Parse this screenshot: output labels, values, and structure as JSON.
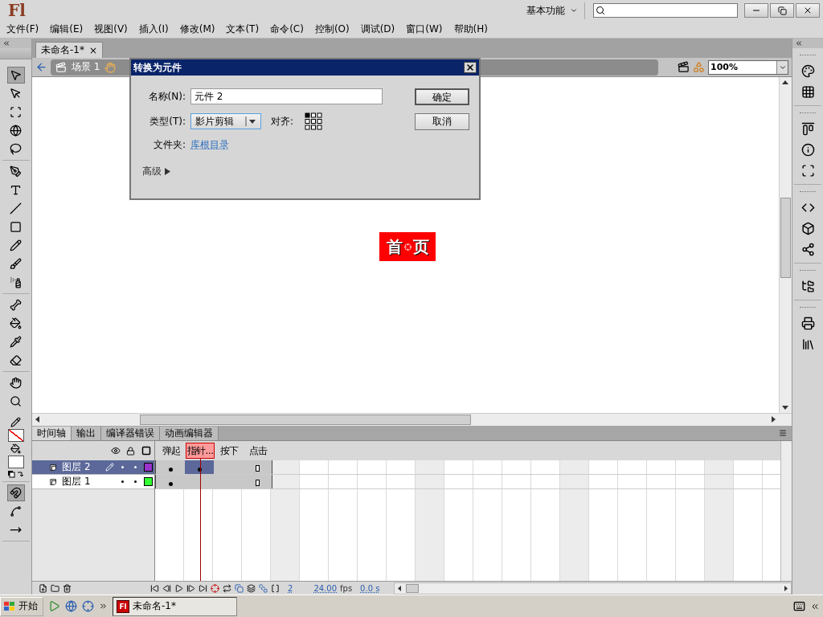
{
  "app": {
    "logo": "Fl",
    "workspace": "基本功能"
  },
  "menu": [
    "文件(F)",
    "编辑(E)",
    "视图(V)",
    "插入(I)",
    "修改(M)",
    "文本(T)",
    "命令(C)",
    "控制(O)",
    "调试(D)",
    "窗口(W)",
    "帮助(H)"
  ],
  "document_tab": {
    "title": "未命名-1*",
    "close": "×"
  },
  "edit_bar": {
    "scene": "场景 1",
    "zoom": "100%"
  },
  "tool_groups": [
    {
      "tools": [
        {
          "kind": "selection",
          "selected": true
        },
        {
          "kind": "subselection",
          "selected": false
        },
        {
          "kind": "transform",
          "selected": false
        },
        {
          "kind": "rotation",
          "selected": false
        },
        {
          "kind": "lasso",
          "selected": false
        }
      ]
    },
    {
      "tools": [
        {
          "kind": "pen",
          "selected": false
        },
        {
          "kind": "text",
          "selected": false
        },
        {
          "kind": "line",
          "selected": false
        },
        {
          "kind": "rectangle",
          "selected": false
        },
        {
          "kind": "pencil",
          "selected": false
        },
        {
          "kind": "brush",
          "selected": false
        },
        {
          "kind": "deco",
          "selected": false
        }
      ]
    },
    {
      "tools": [
        {
          "kind": "bone",
          "selected": false
        },
        {
          "kind": "bucket",
          "selected": false
        },
        {
          "kind": "eyedropper",
          "selected": false
        },
        {
          "kind": "eraser",
          "selected": false
        }
      ]
    },
    {
      "tools": [
        {
          "kind": "hand",
          "selected": false
        },
        {
          "kind": "zoom",
          "selected": false
        }
      ]
    },
    {
      "tools": [
        {
          "kind": "snap",
          "selected": true
        },
        {
          "kind": "smooth",
          "selected": false
        },
        {
          "kind": "straighten",
          "selected": false
        }
      ]
    }
  ],
  "stage": {
    "graphic_text": [
      "首",
      "页"
    ]
  },
  "dialog": {
    "title": "转换为元件",
    "name_label": "名称(N):",
    "name_value": "元件 2",
    "type_label": "类型(T):",
    "type_value": "影片剪辑",
    "align_label": "对齐:",
    "folder_label": "文件夹:",
    "folder_link": "库根目录",
    "advanced": "高级",
    "buttons": [
      "确定",
      "取消"
    ]
  },
  "timeline": {
    "tabs": [
      {
        "label": "时间轴",
        "selected": true
      },
      {
        "label": "输出",
        "selected": false
      },
      {
        "label": "编译器错误",
        "selected": false
      },
      {
        "label": "动画编辑器",
        "selected": false
      }
    ],
    "frame_labels": [
      {
        "label": "弹起",
        "selected": false
      },
      {
        "label": "指针...",
        "selected": true
      },
      {
        "label": "按下",
        "selected": false
      },
      {
        "label": "点击",
        "selected": false
      }
    ],
    "layers": [
      {
        "name": "图层 2",
        "selected": true,
        "color": "#9933cc",
        "frames": [
          {
            "kind": "keyframe",
            "selected": false
          },
          {
            "kind": "keyframe",
            "selected": true
          },
          {
            "kind": "frame",
            "selected": false
          },
          {
            "kind": "end",
            "selected": false
          }
        ]
      },
      {
        "name": "图层 1",
        "selected": false,
        "color": "#33ff33",
        "frames": [
          {
            "kind": "keyframe",
            "selected": false
          },
          {
            "kind": "frame",
            "selected": false
          },
          {
            "kind": "frame",
            "selected": false
          },
          {
            "kind": "end",
            "selected": false
          }
        ]
      }
    ],
    "status": {
      "frame": "2",
      "fps": "24.00",
      "fps_unit": "fps",
      "time": "0.0 s"
    }
  },
  "taskbar": {
    "start": "开始",
    "window": "未命名-1*",
    "window_icon": "Fl"
  }
}
